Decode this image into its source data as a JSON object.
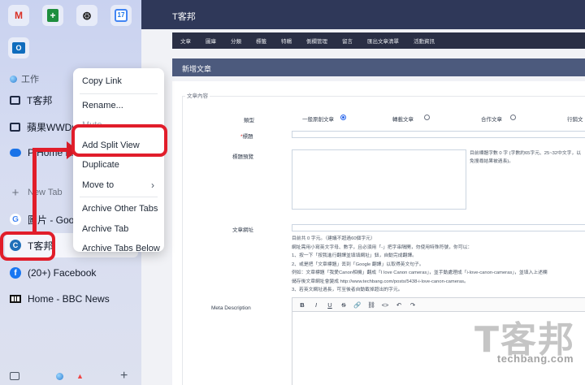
{
  "favorites": [
    {
      "name": "gmail",
      "glyph": "M"
    },
    {
      "name": "google-sheets",
      "glyph": "+"
    },
    {
      "name": "chatgpt",
      "glyph": "⊛"
    },
    {
      "name": "google-calendar",
      "glyph": "17"
    },
    {
      "name": "outlook",
      "glyph": "O"
    }
  ],
  "sidebar": {
    "space_label": "工作",
    "tabs": {
      "folder1": "T客邦",
      "folder2": "蘋果WWDC",
      "home": "P Home NAS",
      "new_tab": "New Tab",
      "google": "圖片 - Google",
      "tkb": "T客邦",
      "facebook": "(20+) Facebook",
      "bbc": "Home - BBC News"
    }
  },
  "context_menu": {
    "copy_link": "Copy Link",
    "rename": "Rename...",
    "mute": "Mute",
    "add_split_view": "Add Split View",
    "duplicate": "Duplicate",
    "move_to": "Move to",
    "archive_other": "Archive Other Tabs",
    "archive_tab": "Archive Tab",
    "archive_below": "Archive Tabs Below"
  },
  "page": {
    "site_title": "T客邦",
    "nav": [
      "文章",
      "圖庫",
      "分類",
      "標籤",
      "特輯",
      "側欄管理",
      "留言",
      "匯出文章清單",
      "活動資訊"
    ],
    "panel_title": "新增文章",
    "legend": "文章內容",
    "type_label": "類型",
    "type_options": [
      "一般原創文章",
      "轉載文章",
      "合作文章",
      "行銷文"
    ],
    "selected_type": "一般原創文章",
    "title_label": "標題",
    "title_preview_label": "標題預覽",
    "title_preview_note1": "目前標題字數  0  字 (字數約65字元、25~32中文字，以",
    "title_preview_note2": "免搜尋結果被過長)。",
    "url_label": "文章網址",
    "help_lines": [
      "目前共 0 字元。（建議不超過60個字元）",
      "網址需用小寫英文字母、數字，且必須用「-」把字串隔開，勿使用特殊符號，你可以：",
      "1、按一下「按我進行翻譯並填填網址」鈕，自動完成翻譯。",
      "2、或是把「文章標題」丟到「Google 翻譯」以取得英文句子。",
      "例如：文章標題「我愛Canon相機」翻成「I love Canon cameras」，並手動處理成「i-love-canon-cameras」，並填入上述欄",
      "儲存後文章網址會變成 http://www.techbang.com/posts/5438-i-love-canon-cameras。",
      "3、若英文網址過長，可至後者自動截掉超出的字元。"
    ],
    "meta_label": "Meta Description",
    "editor_tools": [
      "B",
      "I",
      "U",
      "S",
      "🔗",
      "⛓",
      "<>",
      "↶",
      "↷"
    ]
  },
  "watermark": {
    "big": "T客邦",
    "small": "techbang.com"
  },
  "colors": {
    "highlight": "#e11d2a",
    "header": "#2f3859",
    "nav": "#2a2f45",
    "panel_head": "#4c5a7d"
  }
}
